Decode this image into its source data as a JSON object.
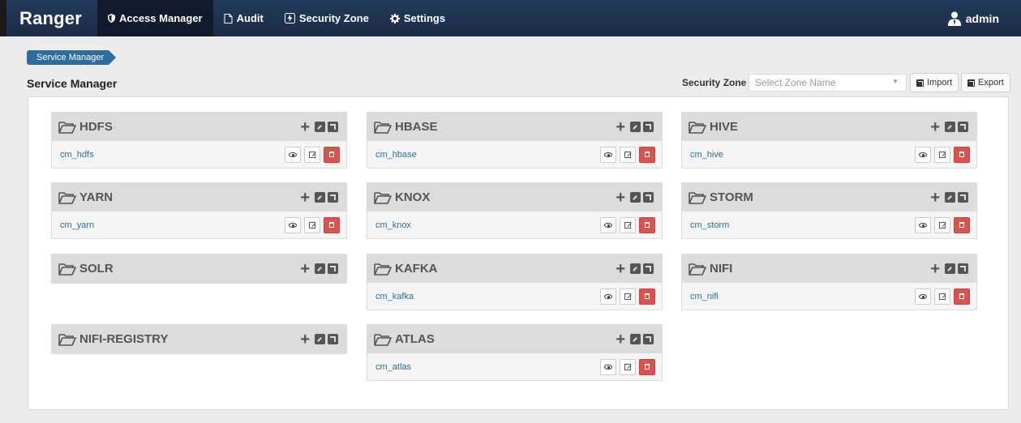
{
  "navbar": {
    "brand": "Ranger",
    "items": [
      {
        "label": "Access Manager",
        "icon": "shield-icon",
        "active": true
      },
      {
        "label": "Audit",
        "icon": "file-icon",
        "active": false
      },
      {
        "label": "Security Zone",
        "icon": "bolt-icon",
        "active": false
      },
      {
        "label": "Settings",
        "icon": "gear-icon",
        "active": false
      }
    ],
    "user": "admin",
    "colors": {
      "bar": "#1a2b47",
      "active": "#111a2b"
    }
  },
  "breadcrumb": {
    "items": [
      "Service Manager"
    ],
    "color": "#2a6d9e"
  },
  "page": {
    "title": "Service Manager"
  },
  "zone": {
    "label": "Security Zone :",
    "placeholder": "Select Zone Name",
    "import_label": "Import",
    "export_label": "Export"
  },
  "services": [
    {
      "type": "HDFS",
      "instances": [
        "cm_hdfs"
      ]
    },
    {
      "type": "HBASE",
      "instances": [
        "cm_hbase"
      ]
    },
    {
      "type": "HIVE",
      "instances": [
        "cm_hive"
      ]
    },
    {
      "type": "YARN",
      "instances": [
        "cm_yarn"
      ]
    },
    {
      "type": "KNOX",
      "instances": [
        "cm_knox"
      ]
    },
    {
      "type": "STORM",
      "instances": [
        "cm_storm"
      ]
    },
    {
      "type": "SOLR",
      "instances": []
    },
    {
      "type": "KAFKA",
      "instances": [
        "cm_kafka"
      ]
    },
    {
      "type": "NIFI",
      "instances": [
        "cm_nifi"
      ]
    },
    {
      "type": "NIFI-REGISTRY",
      "instances": []
    },
    {
      "type": "ATLAS",
      "instances": [
        "cm_atlas"
      ]
    }
  ],
  "theme": {
    "link": "#2a6d9e",
    "delete": "#d9534f",
    "header": "#dcdcdc"
  }
}
